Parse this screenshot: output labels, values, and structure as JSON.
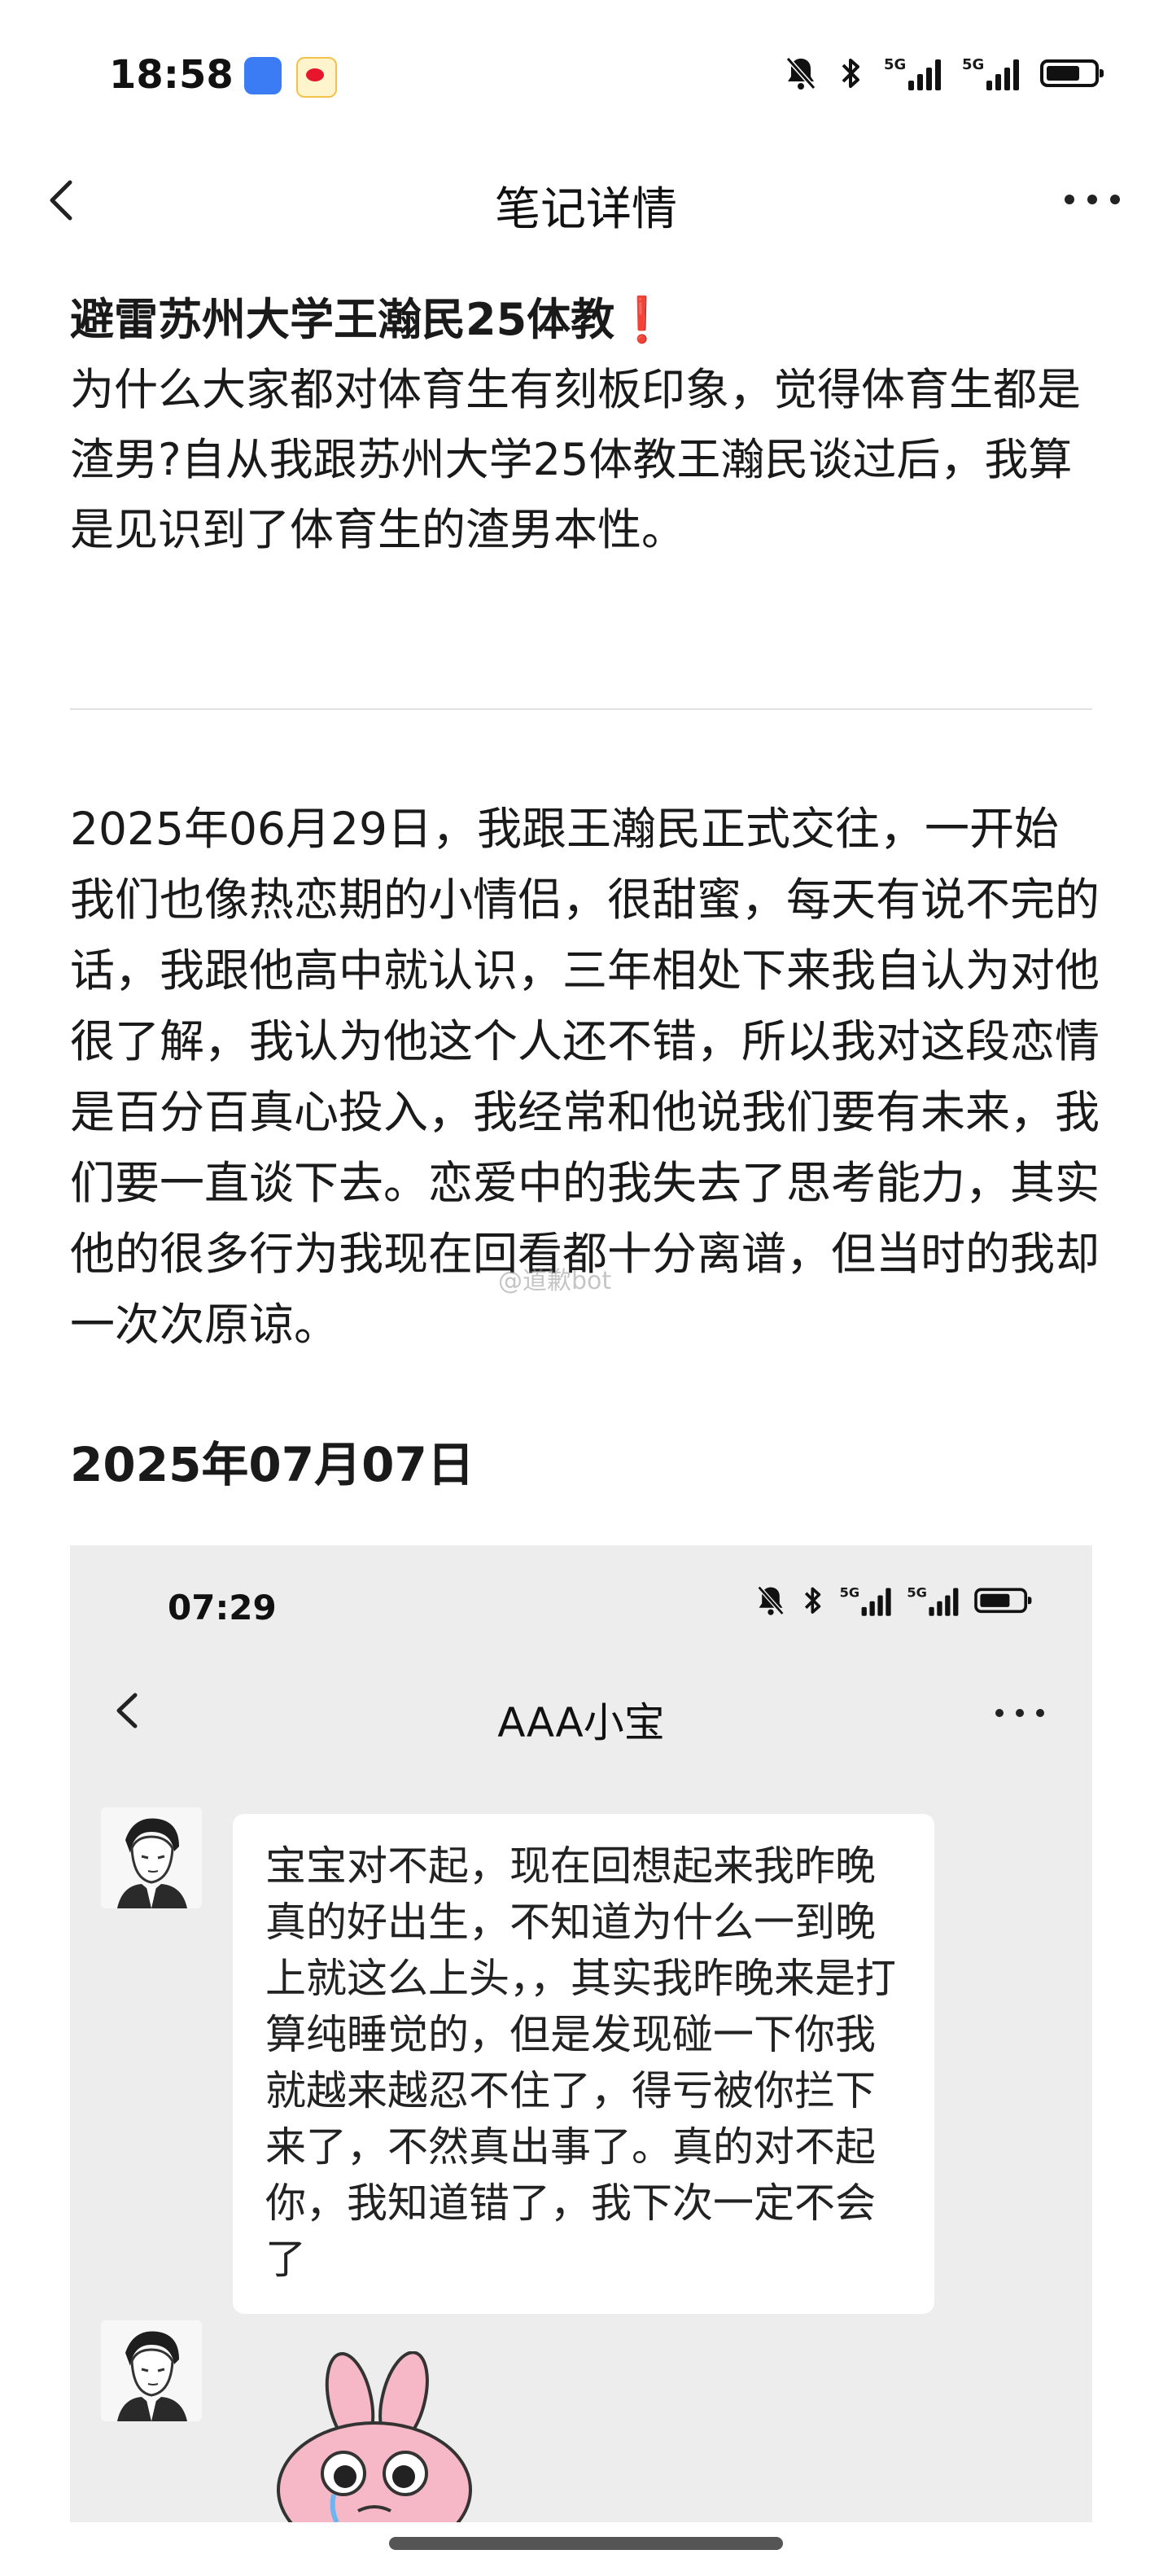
{
  "status_bar": {
    "time": "18:58",
    "signal1_tag": "5G",
    "signal2_tag": "5G"
  },
  "nav": {
    "title": "笔记详情"
  },
  "article": {
    "headline": "避雷苏州大学王瀚民25体教",
    "headline_mark": "❗",
    "intro": "为什么大家都对体育生有刻板印象，觉得体育生都是渣男?自从我跟苏州大学25体教王瀚民谈过后，我算是见识到了体育生的渣男本性。",
    "body": "2025年06月29日，我跟王瀚民正式交往，一开始我们也像热恋期的小情侣，很甜蜜，每天有说不完的话，我跟他高中就认识，三年相处下来我自认为对他很了解，我认为他这个人还不错，所以我对这段恋情是百分百真心投入，我经常和他说我们要有未来，我们要一直谈下去。恋爱中的我失去了思考能力，其实他的很多行为我现在回看都十分离谱，但当时的我却一次次原谅。",
    "date_heading": "2025年07月07日",
    "watermark": "@道歉bot"
  },
  "screenshot": {
    "time": "07:29",
    "signal1_tag": "5G",
    "signal2_tag": "5G",
    "chat_title": "AAA小宝",
    "message": "宝宝对不起，现在回想起来我昨晚真的好出生，不知道为什么一到晚上就这么上头，，其实我昨晚来是打算纯睡觉的，但是发现碰一下你我就越来越忍不住了，得亏被你拦下来了，不然真出事了。真的对不起你，我知道错了，我下次一定不会了"
  },
  "colors": {
    "accent_red": "#e8332a",
    "sticker_pink": "#f6b8c6"
  }
}
